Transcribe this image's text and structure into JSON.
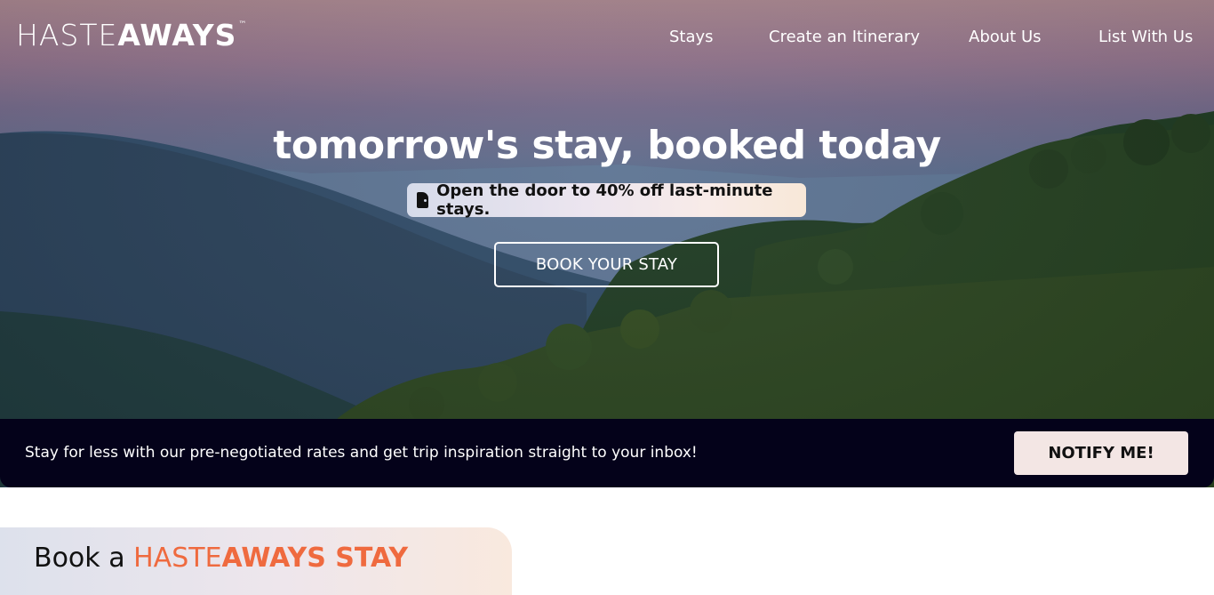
{
  "header": {
    "logo": {
      "part1": "HASTE",
      "part2": "AWAYS",
      "tm": "™"
    },
    "nav": [
      {
        "label": "Stays"
      },
      {
        "label": "Create an Itinerary"
      },
      {
        "label": "About Us"
      },
      {
        "label": "List With Us"
      }
    ]
  },
  "hero": {
    "headline": "tomorrow's stay, booked today",
    "promo_icon": "door-icon",
    "promo_text": "Open the door to 40% off last-minute stays.",
    "cta_label": "BOOK YOUR STAY"
  },
  "banner": {
    "message": "Stay for less with our pre-negotiated rates and get trip inspiration straight to your inbox!",
    "button_label": "NOTIFY ME!"
  },
  "section": {
    "prefix": "Book a ",
    "brand_part1": "HASTE",
    "brand_part2": "AWAYS STAY"
  },
  "colors": {
    "banner_bg": "#04021a",
    "accent": "#ef6a3f",
    "notify_bg": "#f3e6e4"
  }
}
